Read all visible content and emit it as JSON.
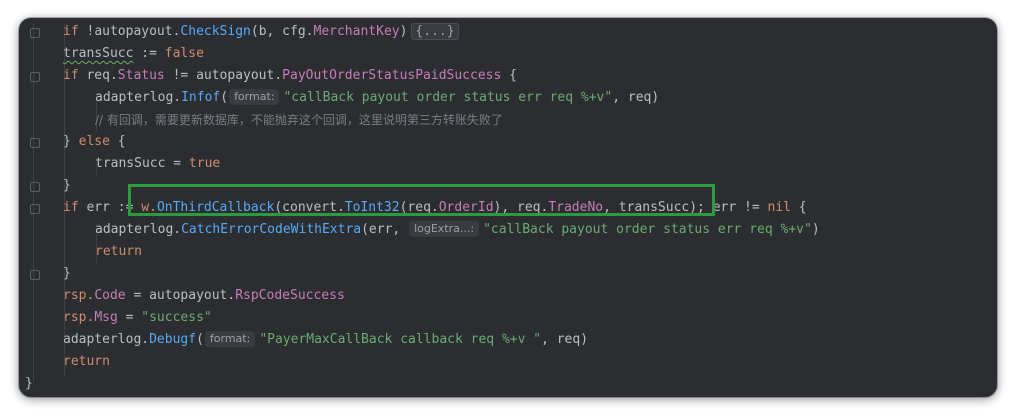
{
  "code": {
    "l1": {
      "kw_if": "if",
      "bang": " !",
      "pkg": "autopayout",
      "dot": ".",
      "fn": "CheckSign",
      "args1": "(b, cfg.",
      "field": "MerchantKey",
      "args2": ")",
      "fold": "{...}"
    },
    "l2": {
      "var": "transSucc",
      "op": " := ",
      "val": "false"
    },
    "l3": {
      "kw_if": "if",
      "sp": " req.",
      "field": "Status",
      "op": " != autopayout.",
      "fn": "PayOutOrderStatusPaidSuccess",
      "brace": " {"
    },
    "l4": {
      "pkg": "adapterlog.",
      "fn": "Infof",
      "paren": "(",
      "hint": "format:",
      "str": "\"callBack payout order status err req %+v\"",
      "rest": ", req)"
    },
    "l5": {
      "comment": "// 有回调，需要更新数据库，不能抛弃这个回调，这里说明第三方转账失败了"
    },
    "l6": {
      "brace": "} ",
      "kw_else": "else",
      "open": " {"
    },
    "l7": {
      "var": "transSucc = ",
      "val": "true"
    },
    "l8": {
      "brace": "}"
    },
    "l9": {
      "kw_if": "if",
      "pre": " err := ",
      "obj": "w.",
      "fn": "OnThirdCallback",
      "p1": "(convert.",
      "fn2": "ToInt32",
      "p2": "(req.",
      "field1": "OrderId",
      "p3": "), req.",
      "field2": "TradeNo",
      "p4": ", transSucc); err != ",
      "kw_nil": "nil",
      "open": " {"
    },
    "l10": {
      "pkg": "adapterlog.",
      "fn": "CatchErrorCodeWithExtra",
      "args": "(err, ",
      "hint": "logExtra...:",
      "str": "\"callBack payout order status err req %+v\"",
      "rest": ")"
    },
    "l11": {
      "kw_return": "return"
    },
    "l12": {
      "brace": "}"
    },
    "l13": {
      "obj": "rsp.",
      "field": "Code",
      "rest": " = autopayout.",
      "fn": "RspCodeSuccess"
    },
    "l14": {
      "obj": "rsp.",
      "field": "Msg",
      "rest": " = ",
      "str": "\"success\""
    },
    "l15": {
      "pkg": "adapterlog.",
      "fn": "Debugf",
      "paren": "(",
      "hint": "format:",
      "str": "\"PayerMaxCallBack callback req %+v \"",
      "rest": ", req)"
    },
    "l16": {
      "kw_return": "return"
    },
    "l17": {
      "brace": "}"
    }
  },
  "colors": {
    "background": "#2b2d30",
    "keyword": "#cf8e6d",
    "function": "#57aaf7",
    "string": "#6aab73",
    "field": "#c77dbb",
    "comment": "#7a7e85",
    "highlight_box": "#2e9a3e"
  }
}
